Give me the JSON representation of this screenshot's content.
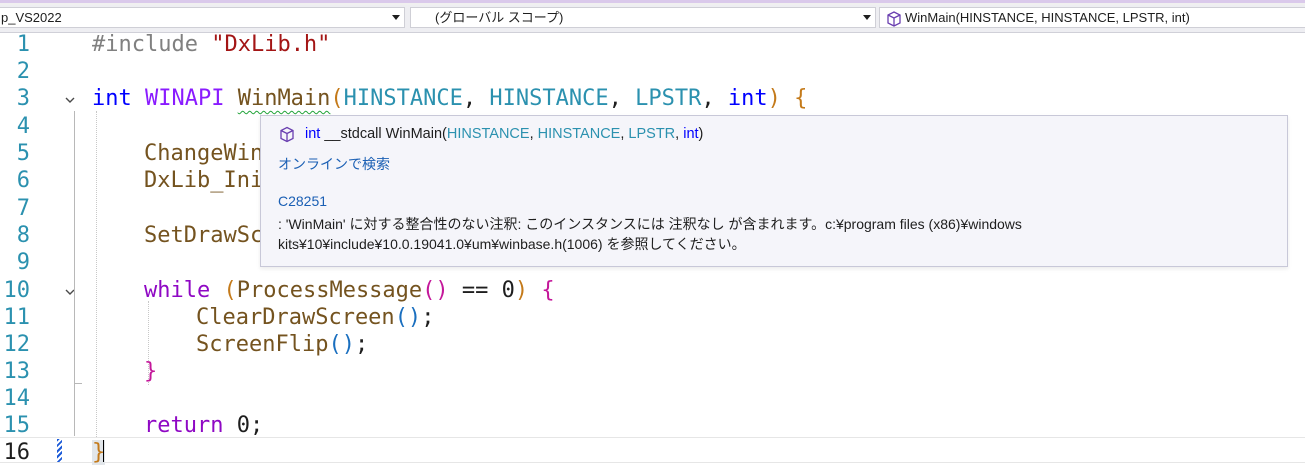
{
  "navbar": {
    "project": "p_VS2022",
    "scope": "(グローバル スコープ)",
    "member": "WinMain(HINSTANCE, HINSTANCE, LPSTR, int)"
  },
  "code": {
    "line_numbers": [
      "1",
      "2",
      "3",
      "4",
      "5",
      "6",
      "7",
      "8",
      "9",
      "10",
      "11",
      "12",
      "13",
      "14",
      "15",
      "16"
    ],
    "l1_directive": "#include ",
    "l1_string": "\"DxLib.h\"",
    "l3_int": "int ",
    "l3_winapi": "WINAPI ",
    "l3_fn": "WinMain",
    "l3_open": "(",
    "l3_t1": "HINSTANCE",
    "l3_c1": ", ",
    "l3_t2": "HINSTANCE",
    "l3_c2": ", ",
    "l3_t3": "LPSTR",
    "l3_c3": ", ",
    "l3_t4": "int",
    "l3_close": ")",
    "l3_brace": " {",
    "l5": "ChangeWin",
    "l6": "DxLib_Ini",
    "l8": "SetDrawSc",
    "l10_kw": "while ",
    "l10_open": "(",
    "l10_fn": "ProcessMessage",
    "l10_call": "()",
    "l10_rest": " == 0",
    "l10_close": ")",
    "l10_brace": " {",
    "l11_fn": "ClearDrawScreen",
    "l11_call": "()",
    "l11_semi": ";",
    "l12_fn": "ScreenFlip",
    "l12_call": "()",
    "l12_semi": ";",
    "l13_brace": "}",
    "l15_kw": "return ",
    "l15_rest": "0;",
    "l16_brace": "}"
  },
  "tooltip": {
    "sig_int": "int",
    "sig_call": " __stdcall WinMain(",
    "sig_t1": "HINSTANCE",
    "sig_c1": ", ",
    "sig_t2": "HINSTANCE",
    "sig_c2": ", ",
    "sig_t3": "LPSTR",
    "sig_c3": ", ",
    "sig_t4": "int",
    "sig_end": ")",
    "search_link": "オンラインで検索",
    "warning_code": "C28251",
    "warning_text": ": 'WinMain' に対する整合性のない注釈: このインスタンスには 注釈なし が含まれます。c:¥program files (x86)¥windows kits¥10¥include¥10.0.19041.0¥um¥winbase.h(1006) を参照してください。"
  },
  "icons": [
    "cube-icon",
    "chevron-down-icon",
    "fold-arrow-icon"
  ]
}
